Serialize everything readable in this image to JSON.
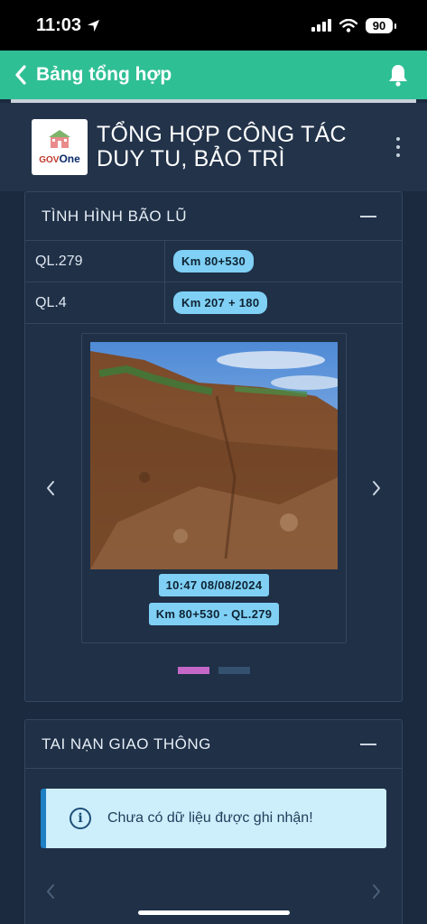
{
  "status_bar": {
    "time": "11:03",
    "battery": "90"
  },
  "app_bar": {
    "title": "Bảng tổng hợp"
  },
  "header": {
    "title": "TỔNG HỢP CÔNG TÁC DUY TU, BẢO TRÌ",
    "logo_text_a": "GOV",
    "logo_text_b": "One"
  },
  "storm_section": {
    "title": "TÌNH HÌNH BÃO LŨ",
    "rows": [
      {
        "road": "QL.279",
        "km": "Km 80+530"
      },
      {
        "road": "QL.4",
        "km": "Km 207 + 180"
      }
    ],
    "slide": {
      "timestamp": "10:47 08/08/2024",
      "location": "Km 80+530 - QL.279"
    },
    "slide_count": 2,
    "active_slide": 1
  },
  "accident_section": {
    "title": "TAI NẠN GIAO THÔNG",
    "empty_message": "Chưa có dữ liệu được ghi nhận!"
  },
  "colors": {
    "accent": "#2fbf95",
    "pill": "#7fd0f4",
    "dot_active": "#c567c9"
  }
}
